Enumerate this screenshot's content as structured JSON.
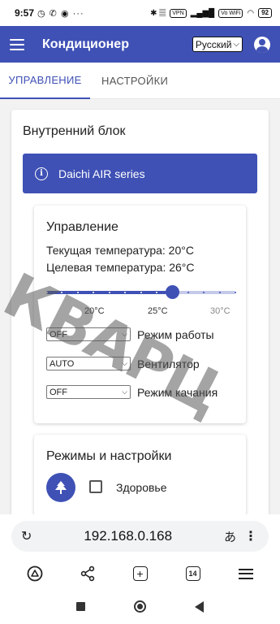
{
  "status": {
    "time": "9:57",
    "left_icons": "◷ ✆ ◉ ···",
    "right_icons": "✱ 𝄚",
    "vpn": "VPN",
    "network": "Vo WiFi",
    "battery": "92"
  },
  "appbar": {
    "title": "Кондиционер",
    "language": "Русский"
  },
  "tabs": [
    {
      "label": "УПРАВЛЕНИЕ",
      "active": true
    },
    {
      "label": "НАСТРОЙКИ",
      "active": false
    }
  ],
  "unit": {
    "title": "Внутренний блок",
    "info_icon": "i",
    "model": "Daichi AIR series"
  },
  "control": {
    "title": "Управление",
    "current_temp": "Текущая температура: 20°C",
    "target_temp": "Целевая температура: 26°C",
    "slider": {
      "min": 18,
      "max": 30,
      "value": 26
    },
    "tick_labels": [
      "20°C",
      "25°C",
      "30°C"
    ],
    "mode_value": "OFF",
    "mode_label": "Режим работы",
    "fan_value": "AUTO",
    "fan_label": "Вентилятор",
    "swing_value": "OFF",
    "swing_label": "Режим качания",
    "chevron": "⌵"
  },
  "modes": {
    "title": "Режимы и настройки",
    "health_icon": "tree-icon",
    "health_label": "Здоровье"
  },
  "watermark": "КВАРЦ",
  "browser": {
    "reload": "↻",
    "url": "192.168.0.168",
    "translate": "あ",
    "menu": "⋮",
    "tab_count": "14"
  },
  "colors": {
    "primary": "#3f51b5",
    "track_light": "#c5cae9"
  }
}
